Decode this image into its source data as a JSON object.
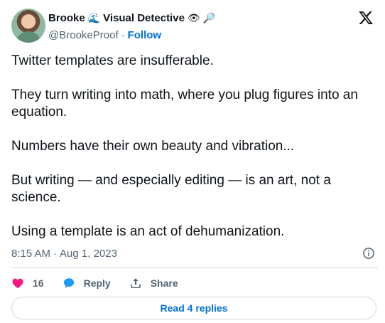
{
  "author": {
    "display_name": "Brooke",
    "name_emoji_1": "🌊",
    "title": "Visual Detective",
    "name_emoji_2": "👁",
    "name_emoji_3": "🔎",
    "handle": "@BrookeProof",
    "separator": "·",
    "follow_label": "Follow"
  },
  "tweet": {
    "paragraphs": [
      "Twitter templates are insufferable.",
      "They turn writing into math, where you plug figures into an equation.",
      "Numbers have their own beauty and vibration...",
      "But writing — and especially editing — is an art, not a science.",
      "Using a template is an act of dehumanization."
    ],
    "time": "8:15 AM",
    "date_separator": "·",
    "date": "Aug 1, 2023"
  },
  "actions": {
    "like_count": "16",
    "reply_label": "Reply",
    "share_label": "Share"
  },
  "footer": {
    "read_replies_label": "Read 4 replies"
  },
  "colors": {
    "like": "#f91880",
    "link": "#006fd6",
    "reply_icon": "#1d9bf0",
    "secondary_text": "#536471",
    "border": "#cfd9de"
  },
  "icons": {
    "brand": "x-logo-icon",
    "info": "info-icon",
    "like": "heart-icon",
    "reply": "speech-bubble-icon",
    "share": "share-upload-icon"
  }
}
